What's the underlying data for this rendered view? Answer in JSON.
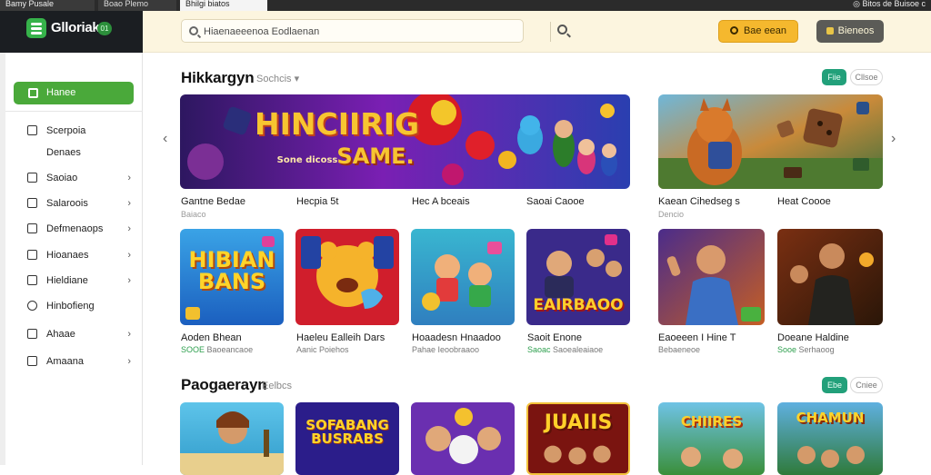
{
  "browser": {
    "tabs": [
      "Bamy Pusale",
      "Boao Plemo",
      "Bhilgi biatos"
    ],
    "right_text": "◎ Bitos de   Buisoe c"
  },
  "logo": {
    "name": "Glloriak",
    "badge": "01"
  },
  "search": {
    "placeholder": "Hiaenaeeenoa Eodlaenan"
  },
  "header": {
    "primary_btn": "Bae eean",
    "secondary_btn": "Bieneos"
  },
  "sidebar": {
    "home": "Hanee",
    "items": [
      {
        "label": "Scerpoia",
        "chevron": ""
      },
      {
        "label": "Denaes",
        "chevron": ""
      },
      {
        "label": "Saoiao",
        "chevron": "›"
      },
      {
        "label": "Salaroois",
        "chevron": "›"
      },
      {
        "label": "Defmenaops",
        "chevron": "›"
      },
      {
        "label": "Hioanaes",
        "chevron": "›"
      },
      {
        "label": "Hieldiane",
        "chevron": "›"
      },
      {
        "label": "Hinbofieng",
        "chevron": ""
      },
      {
        "label": "Ahaae",
        "chevron": "›"
      },
      {
        "label": "Amaana",
        "chevron": "›"
      }
    ]
  },
  "section1": {
    "title": "Hikkargyn",
    "subtitle": "Sochcis ▾",
    "pill_green": "Fiie",
    "pill_white": "Cllsoe",
    "banner_cards": [
      {
        "words": [
          "HINCIIRIG",
          "SAME."
        ],
        "sub_word": "Sone dicoss",
        "title": "Gantne Bedae",
        "sub": "Baiaco"
      },
      {
        "words": [],
        "sub_word": "",
        "title": "Kaean Cihedseg s",
        "sub": "Dencio"
      }
    ],
    "extra_labels": [
      "Hecpia 5t",
      "Hec A bceais",
      "Saoai Caooe",
      "Heat Coooe"
    ],
    "cards": [
      {
        "word": "HIBIAN BANS",
        "title": "Aoden Bhean",
        "meta_green": "SOOE",
        "meta": "Baoeancaoe"
      },
      {
        "word": "",
        "title": "Haeleu Ealleih Dars",
        "meta_green": "",
        "meta": "Aanic Poiehos"
      },
      {
        "word": "",
        "title": "Hoaadesn Hnaadoo",
        "meta_green": "",
        "meta": "Pahae Ieoobraaoo"
      },
      {
        "word": "EAIRBAOO",
        "title": "Saoit Enone",
        "meta_green": "Saoac",
        "meta": "Saoealeaiaoe"
      },
      {
        "word": "",
        "title": "Eaoeeen I Hine T",
        "meta_green": "",
        "meta": "Bebaeneoe"
      },
      {
        "word": "",
        "title": "Doeane Haldine",
        "meta_green": "Sooe",
        "meta": "Serhaoog"
      }
    ]
  },
  "section2": {
    "title": "Paogaerayn",
    "subtitle": "Eelbcs",
    "pill_green": "Ebe",
    "pill_white": "Cniee",
    "cards": [
      {
        "word": ""
      },
      {
        "word": "SOFABANG BUSRABS"
      },
      {
        "word": ""
      },
      {
        "word": "JUAIIS"
      },
      {
        "word": "CHIIRES"
      },
      {
        "word": "CHAMUN"
      }
    ]
  },
  "colors": {
    "accent_green": "#4aa93a",
    "header_bg": "#fcf5df",
    "yellow_btn": "#f5b82e"
  }
}
